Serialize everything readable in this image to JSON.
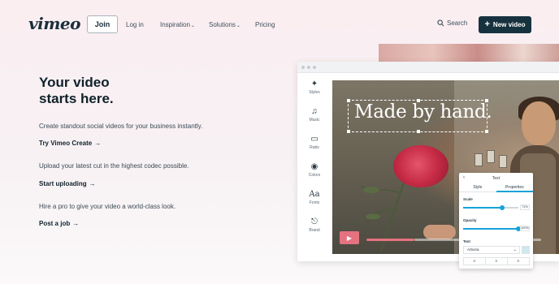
{
  "nav": {
    "logo": "vimeo",
    "join_label": "Join",
    "login_label": "Log in",
    "inspiration_label": "Inspiration",
    "solutions_label": "Solutions",
    "pricing_label": "Pricing",
    "search_label": "Search",
    "new_video_label": "New video"
  },
  "hero": {
    "title_line1": "Your video",
    "title_line2": "starts here.",
    "items": [
      {
        "desc": "Create standout social videos for your business instantly.",
        "cta": "Try Vimeo Create"
      },
      {
        "desc": "Upload your latest cut in the highest codec possible.",
        "cta": "Start uploading"
      },
      {
        "desc": "Hire a pro to give your video a world-class look.",
        "cta": "Post a job"
      }
    ]
  },
  "editor": {
    "tools": [
      {
        "icon": "styles-icon",
        "label": "Styles"
      },
      {
        "icon": "music-icon",
        "label": "Music"
      },
      {
        "icon": "ratio-icon",
        "label": "Ratio"
      },
      {
        "icon": "colors-icon",
        "label": "Colors"
      },
      {
        "icon": "fonts-icon",
        "label": "Fonts"
      },
      {
        "icon": "brand-icon",
        "label": "Brand"
      }
    ],
    "headline": "Made by hand.",
    "playback_progress": 0.47,
    "panel": {
      "title": "Text",
      "tabs": [
        "Style",
        "Properties"
      ],
      "active_tab": "Properties",
      "scale_label": "Scale",
      "scale_value": "71%",
      "scale_level": 0.71,
      "opacity_label": "Opacity",
      "opacity_value": "100%",
      "opacity_level": 1.0,
      "text_label": "Text",
      "font_value": "Arboria"
    }
  },
  "colors": {
    "brand": "#17323f",
    "accent": "#17a3d8",
    "play": "#e5727f"
  }
}
